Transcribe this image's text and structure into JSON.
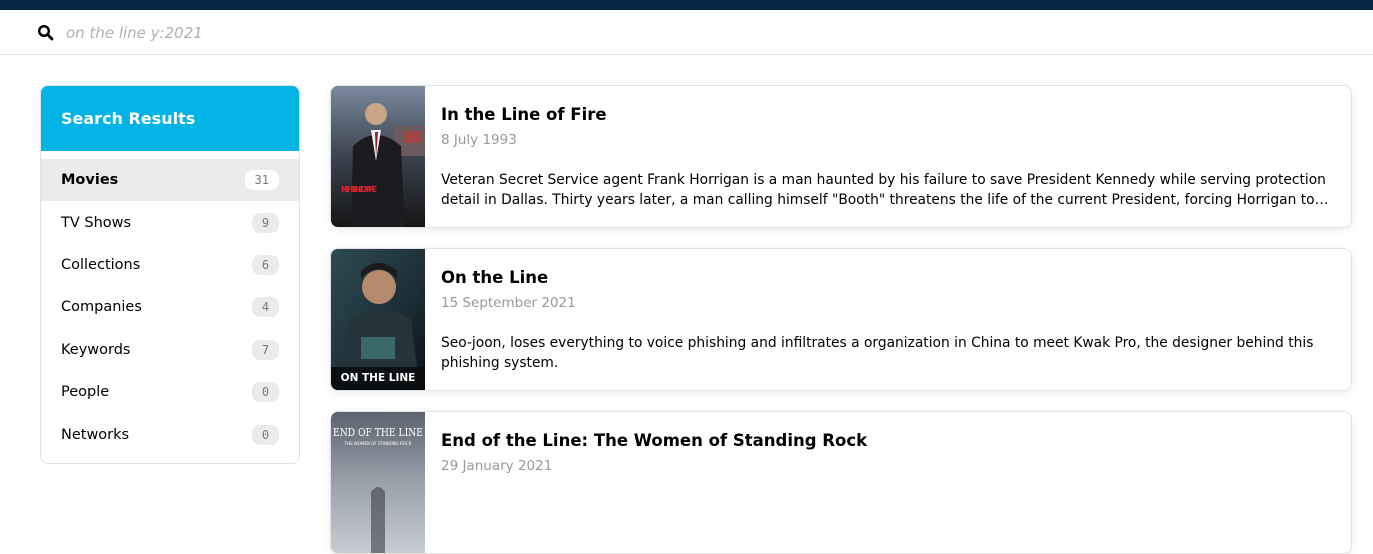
{
  "search": {
    "query": "on the line y:2021"
  },
  "sidebar": {
    "title": "Search Results",
    "items": [
      {
        "label": "Movies",
        "count": "31"
      },
      {
        "label": "TV Shows",
        "count": "9"
      },
      {
        "label": "Collections",
        "count": "6"
      },
      {
        "label": "Companies",
        "count": "4"
      },
      {
        "label": "Keywords",
        "count": "7"
      },
      {
        "label": "People",
        "count": "0"
      },
      {
        "label": "Networks",
        "count": "0"
      }
    ]
  },
  "results": [
    {
      "title": "In the Line of Fire",
      "date": "8 July 1993",
      "overview": "Veteran Secret Service agent Frank Horrigan is a man haunted by his failure to save President Kennedy while serving protection detail in Dallas. Thirty years later, a man calling himself \"Booth\" threatens the life of the current President, forcing Horrigan to come back to the fold.",
      "poster_text": "IN THE LINE OF FIRE"
    },
    {
      "title": "On the Line",
      "date": "15 September 2021",
      "overview": "Seo-joon, loses everything to voice phishing and infiltrates a organization in China to meet Kwak Pro, the designer behind this phishing system.",
      "poster_text": "ON THE LINE"
    },
    {
      "title": "End of the Line: The Women of Standing Rock",
      "date": "29 January 2021",
      "overview": "",
      "poster_text": "END OF THE LINE",
      "poster_subtext": "THE WOMEN OF STANDING ROCK"
    }
  ],
  "colors": {
    "topbar": "#032541",
    "accent": "#01b4e4"
  }
}
